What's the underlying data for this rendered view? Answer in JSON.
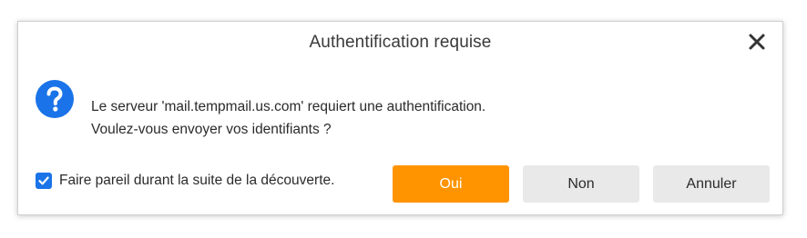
{
  "dialog": {
    "title": "Authentification requise",
    "close_icon": "close-icon",
    "message_icon": "question-icon",
    "message_line1": "Le serveur 'mail.tempmail.us.com' requiert une authentification.",
    "message_line2": "Voulez-vous envoyer vos identifiants ?",
    "checkbox": {
      "checked": true,
      "label": "Faire pareil durant la suite de la découverte."
    },
    "buttons": {
      "yes": "Oui",
      "no": "Non",
      "cancel": "Annuler"
    }
  },
  "colors": {
    "accent_primary": "#ff9400",
    "checkbox": "#1a73e8",
    "question_icon": "#1a73e8",
    "secondary_button": "#e9e9e9"
  }
}
